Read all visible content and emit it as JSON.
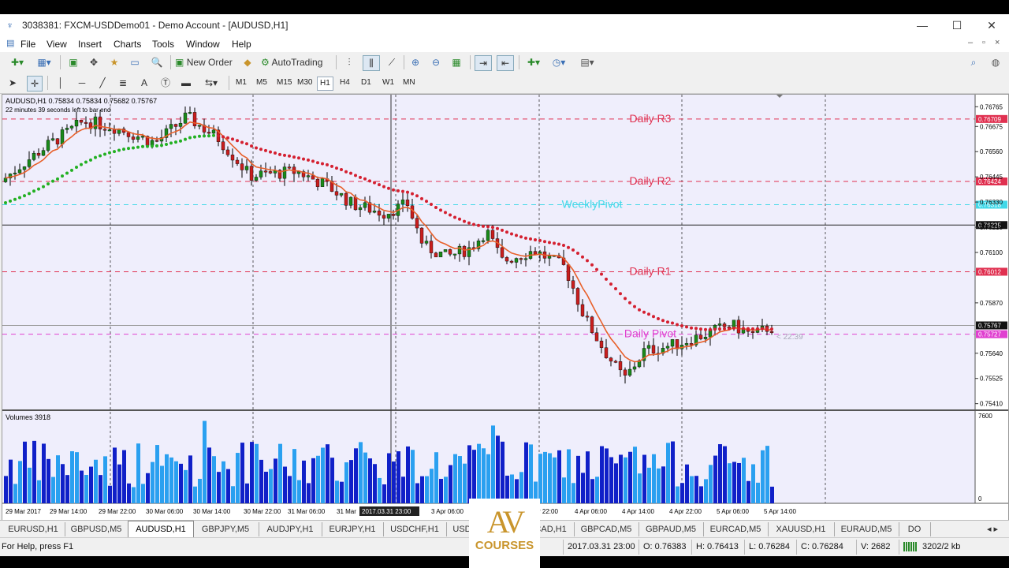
{
  "window": {
    "title": "3038381: FXCM-USDDemo01 - Demo Account - [AUDUSD,H1]",
    "minimize": "—",
    "maximize": "☐",
    "close": "✕"
  },
  "menu": [
    "File",
    "View",
    "Insert",
    "Charts",
    "Tools",
    "Window",
    "Help"
  ],
  "toolbar": {
    "new_order": "New Order",
    "autotrading": "AutoTrading"
  },
  "timeframes": [
    "M1",
    "M5",
    "M15",
    "M30",
    "H1",
    "H4",
    "D1",
    "W1",
    "MN"
  ],
  "selected_timeframe": "H1",
  "chart": {
    "header": "AUDUSD,H1  0.75834 0.75834 0.75682 0.75767",
    "countdown": "22 minutes 39 seconds left to bar end",
    "volumes_label": "Volumes 3918",
    "vol_axis_top": "7600",
    "vol_axis_bottom": "0",
    "timer_label": "< 22:39",
    "crosshair_label": "2017.03.31 23:00",
    "levels": [
      {
        "name": "Daily R3",
        "price": "0.76709",
        "color": "#e03050"
      },
      {
        "name": "Daily R2",
        "price": "0.76424",
        "color": "#e03050"
      },
      {
        "name": "WeeklyPivot",
        "price": "0.76318",
        "color": "#40d8e8"
      },
      {
        "name": "Daily R1",
        "price": "0.76012",
        "color": "#e03050"
      },
      {
        "name": "Daily Pivot",
        "price": "0.75727",
        "color": "#e040d0"
      }
    ],
    "hline_price": "0.76225",
    "bid_price": "0.75767",
    "price_axis": [
      "0.76765",
      "0.76675",
      "0.76560",
      "0.76445",
      "0.76330",
      "0.76215",
      "0.76100",
      "0.75870",
      "0.75640",
      "0.75525",
      "0.75410"
    ],
    "time_axis": [
      "29 Mar 2017",
      "29 Mar 14:00",
      "29 Mar 22:00",
      "30 Mar 06:00",
      "30 Mar 14:00",
      "30 Mar 22:00",
      "31 Mar 06:00",
      "31 Mar",
      "3 Apr 06:00",
      "3 Apr 14:00",
      "3 Apr 22:00",
      "4 Apr 06:00",
      "4 Apr 14:00",
      "4 Apr 22:00",
      "5 Apr 06:00",
      "5 Apr 14:00"
    ]
  },
  "tabs": [
    "EURUSD,H1",
    "GBPUSD,M5",
    "AUDUSD,H1",
    "GBPJPY,M5",
    "AUDJPY,H1",
    "EURJPY,H1",
    "USDCHF,H1",
    "USD",
    "H1",
    "USDCAD,H1",
    "GBPCAD,M5",
    "GBPAUD,M5",
    "EURCAD,M5",
    "XAUUSD,H1",
    "EURAUD,M5",
    "DO"
  ],
  "active_tab": "AUDUSD,H1",
  "status": {
    "help": "For Help, press F1",
    "datetime": "2017.03.31 23:00",
    "open": "O: 0.76383",
    "high": "H: 0.76413",
    "low": "L: 0.76284",
    "close": "C: 0.76284",
    "volume": "V: 2682",
    "traffic": "3202/2 kb"
  },
  "watermark": {
    "logo": "AV",
    "text": "COURSES"
  }
}
